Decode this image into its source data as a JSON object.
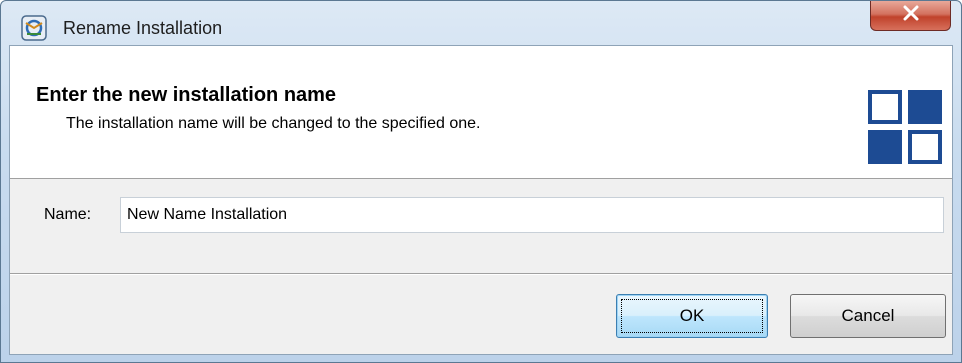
{
  "window": {
    "title": "Rename Installation",
    "app_icon": "installer-icon",
    "close_icon": "close-icon"
  },
  "banner": {
    "title": "Enter the new installation name",
    "description": "The installation name will be changed to the specified one.",
    "logo_icon": "squares-logo-icon"
  },
  "form": {
    "name_label": "Name:",
    "name_value": "New Name Installation"
  },
  "buttons": {
    "ok_label": "OK",
    "cancel_label": "Cancel"
  },
  "colors": {
    "logo_blue": "#1d4b93",
    "close_red": "#c0422b"
  }
}
